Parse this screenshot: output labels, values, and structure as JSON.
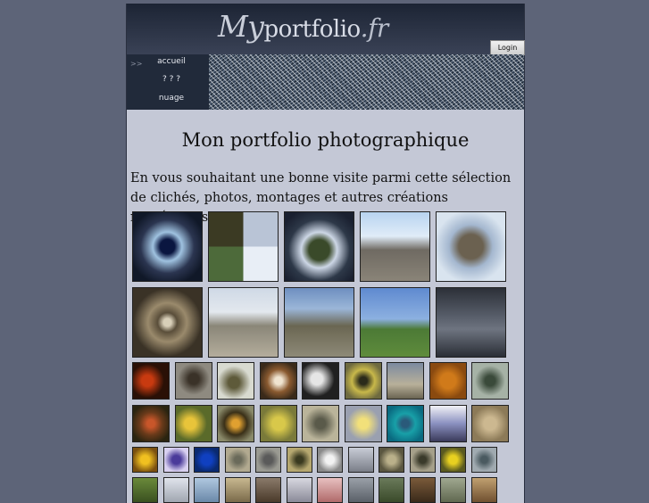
{
  "header": {
    "logo_my": "My",
    "logo_mid": "portfolio",
    "logo_tld": ".fr",
    "login_label": "Login"
  },
  "nav": {
    "arrow": ">>",
    "items": [
      {
        "label": "accueil"
      },
      {
        "label": "? ? ?"
      },
      {
        "label": "nuage"
      }
    ]
  },
  "main": {
    "title": "Mon portfolio photographique",
    "intro": "En vous souhaitant une bonne visite parmi cette sélection de clichés, photos, montages et autres créations numériques..."
  },
  "colors": {
    "page_background": "#5d6478",
    "content_background": "#c4c8d6",
    "header_dark": "#1c2434"
  },
  "gallery": {
    "large_rows": [
      [
        {
          "bg": "radial-gradient(circle at 50% 50%, #0a1640 15%, #9fc2e0 30%, #2b3550 55%, #101828 80%)"
        },
        {
          "bg": "conic-gradient(#b9c4d6 0 25%, #e8eef6 25% 50%, #4d6a3a 50% 75%, #3b3a23 75% 100%)"
        },
        {
          "bg": "radial-gradient(circle at 50% 55%, #3a4a2a 20%, #cdd7e6 35%, #2d3848 60%, #1a2030 85%)"
        },
        {
          "bg": "linear-gradient(180deg, #b8d4f0 0%, #e0ecf8 35%, #6f6a62 55%, #8a8478 100%)"
        },
        {
          "bg": "radial-gradient(circle at 50% 50%, #6b6150 25%, #a4b7cf 45%, #d9e4ef 75%)"
        }
      ],
      [
        {
          "bg": "radial-gradient(circle at 50% 50%, #d8cfb8 8%, #5a4e3a 20%, #9a8a6c 40%, #3a3226 70%)"
        },
        {
          "bg": "linear-gradient(180deg, #cfd9e6 0%, #e3e8ee 35%, #8a8678 55%, #b4ad9c 100%)"
        },
        {
          "bg": "linear-gradient(180deg, #6e8fc0 0%, #9bb6d8 30%, #6a6652 55%, #8e8a78 100%)"
        },
        {
          "bg": "linear-gradient(180deg, #5f8ad0 0%, #8cb0e0 45%, #4c7a36 60%, #5f8c3c 100%)"
        },
        {
          "bg": "linear-gradient(180deg, #2c3038 0%, #565c68 40%, #6e7480 60%, #2a2e36 100%)"
        }
      ]
    ],
    "medium_rows": [
      [
        {
          "bg": "radial-gradient(circle at 40% 50%, #c83a10 20%, #2a1006 60%)"
        },
        {
          "bg": "radial-gradient(circle at 50% 45%, #3a3228 20%, #8e8a80 60%)"
        },
        {
          "bg": "radial-gradient(circle at 45% 55%, #5e5a3a 20%, #d8dad0 60%)"
        },
        {
          "bg": "radial-gradient(circle at 50% 50%, #f0e4d0 15%, #8a5a30 45%, #3a2a1a 80%)"
        },
        {
          "bg": "radial-gradient(circle at 40% 45%, #e6e6e6 20%, #202020 60%)"
        },
        {
          "bg": "radial-gradient(circle at 50% 50%, #2a2a1a 15%, #c8b84a 45%, #6e6a40 80%)"
        },
        {
          "bg": "linear-gradient(180deg, #7c8aa0 0%, #b8b09a 60%, #6a6452 100%)"
        },
        {
          "bg": "radial-gradient(circle at 50% 50%, #d07a1a 30%, #8a4a10 70%)"
        },
        {
          "bg": "radial-gradient(circle at 50% 50%, #3a4a3a 20%, #a6b2a6 60%)"
        }
      ],
      [
        {
          "bg": "radial-gradient(circle at 50% 50%, #c8562a 15%, #6a3a1a 45%, #2a2410 80%)"
        },
        {
          "bg": "radial-gradient(circle at 40% 50%, #e8c43a 20%, #5a6a2a 60%)"
        },
        {
          "bg": "radial-gradient(circle at 50% 50%, #e0a030 15%, #3a3018 45%, #8a8a6a 80%)"
        },
        {
          "bg": "radial-gradient(circle at 50% 50%, #d8c84a 25%, #7a7a3a 70%)"
        },
        {
          "bg": "radial-gradient(circle at 50% 50%, #5a5a4a 20%, #bab49a 65%)"
        },
        {
          "bg": "radial-gradient(circle at 50% 50%, #f2e07a 20%, #9aa0b0 65%)"
        },
        {
          "bg": "radial-gradient(circle at 50% 50%, #2a5a7a 15%, #18a0a8 40%, #0a6a80 80%)"
        },
        {
          "bg": "linear-gradient(180deg, #f2f2f6 0%, #8a90c0 50%, #3a3a5a 100%)"
        },
        {
          "bg": "radial-gradient(circle at 50% 50%, #ccb890 25%, #8c7a58 70%)"
        }
      ]
    ],
    "small_rows": [
      [
        {
          "bg": "radial-gradient(circle at 50% 50%, #f0c020 25%, #7a5010 75%)"
        },
        {
          "bg": "radial-gradient(circle at 50% 50%, #4a3a9a 25%, #d8d0f0 70%)"
        },
        {
          "bg": "radial-gradient(circle at 50% 50%, #1040c0 30%, #0a2a70 70%)"
        },
        {
          "bg": "radial-gradient(circle at 50% 50%, #6a6a5a 20%, #b2aa90 65%)"
        },
        {
          "bg": "radial-gradient(circle at 50% 50%, #5a5a5a 25%, #9a9a92 65%)"
        },
        {
          "bg": "radial-gradient(circle at 50% 50%, #3a3a20 20%, #b6a870 65%)"
        },
        {
          "bg": "radial-gradient(circle at 50% 50%, #f2f2f2 25%, #8a8a8a 70%)"
        },
        {
          "bg": "linear-gradient(180deg, #c8ccd6 0%, #7a7e88 100%)"
        },
        {
          "bg": "radial-gradient(circle at 50% 50%, #bab08a 25%, #5a5640 70%)"
        },
        {
          "bg": "radial-gradient(circle at 50% 50%, #3a3a2a 20%, #a6a08a 65%)"
        },
        {
          "bg": "radial-gradient(circle at 50% 50%, #e8d020 25%, #5a5a20 70%)"
        },
        {
          "bg": "radial-gradient(circle at 50% 50%, #4a5a60 20%, #a0aab0 65%)"
        }
      ],
      [
        {
          "bg": "linear-gradient(180deg, #6a8a3a 0%, #3a5020 100%)"
        },
        {
          "bg": "linear-gradient(180deg, #e0e4ec 0%, #a0a6b0 100%)"
        },
        {
          "bg": "linear-gradient(180deg, #b0c8e0 0%, #6a88a8 100%)"
        },
        {
          "bg": "linear-gradient(180deg, #c8b890 0%, #7a6a4a 100%)"
        },
        {
          "bg": "linear-gradient(180deg, #8a7a6a 0%, #4a3a2a 100%)"
        },
        {
          "bg": "linear-gradient(180deg, #d8d8e0 0%, #8a8a98 100%)"
        },
        {
          "bg": "linear-gradient(180deg, #e8c0c0 0%, #b06a6a 100%)"
        },
        {
          "bg": "linear-gradient(180deg, #9aa0a8 0%, #5a6068 100%)"
        },
        {
          "bg": "linear-gradient(180deg, #6a7a5a 0%, #3a4a2a 100%)"
        },
        {
          "bg": "linear-gradient(180deg, #7a5a3a 0%, #3a2a1a 100%)"
        },
        {
          "bg": "linear-gradient(180deg, #a0a890 0%, #606850 100%)"
        },
        {
          "bg": "linear-gradient(180deg, #c0a070 0%, #705030 100%)"
        }
      ]
    ]
  }
}
